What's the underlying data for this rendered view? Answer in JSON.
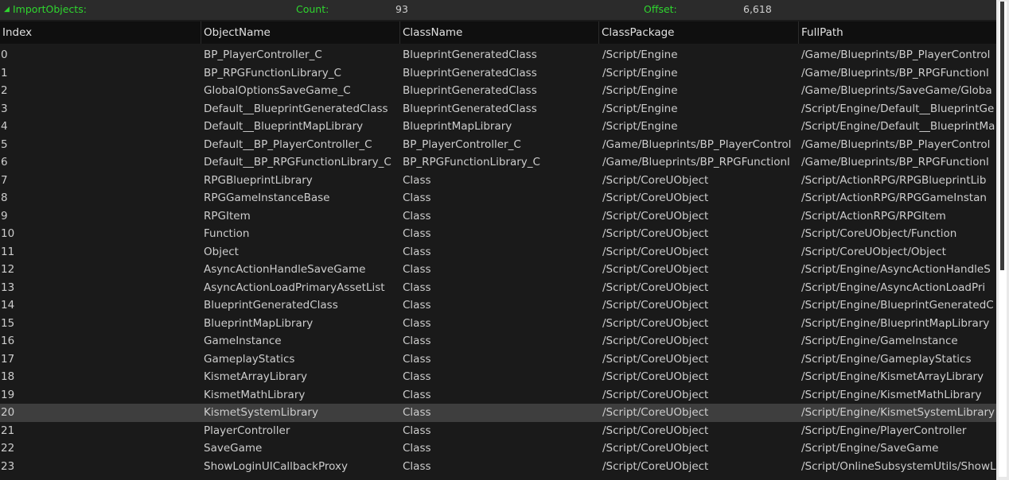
{
  "summary": {
    "title": "ImportObjects:",
    "count_label": "Count:",
    "count_value": "93",
    "offset_label": "Offset:",
    "offset_value": "6,618"
  },
  "columns": [
    "Index",
    "ObjectName",
    "ClassName",
    "ClassPackage",
    "FullPath"
  ],
  "selected_index": "20",
  "rows": [
    [
      "0",
      "BP_PlayerController_C",
      "BlueprintGeneratedClass",
      "/Script/Engine",
      "/Game/Blueprints/BP_PlayerControl"
    ],
    [
      "1",
      "BP_RPGFunctionLibrary_C",
      "BlueprintGeneratedClass",
      "/Script/Engine",
      "/Game/Blueprints/BP_RPGFunctionl"
    ],
    [
      "2",
      "GlobalOptionsSaveGame_C",
      "BlueprintGeneratedClass",
      "/Script/Engine",
      "/Game/Blueprints/SaveGame/Globa"
    ],
    [
      "3",
      "Default__BlueprintGeneratedClass",
      "BlueprintGeneratedClass",
      "/Script/Engine",
      "/Script/Engine/Default__BlueprintGe"
    ],
    [
      "4",
      "Default__BlueprintMapLibrary",
      "BlueprintMapLibrary",
      "/Script/Engine",
      "/Script/Engine/Default__BlueprintMa"
    ],
    [
      "5",
      "Default__BP_PlayerController_C",
      "BP_PlayerController_C",
      "/Game/Blueprints/BP_PlayerControl",
      "/Game/Blueprints/BP_PlayerControl"
    ],
    [
      "6",
      "Default__BP_RPGFunctionLibrary_C",
      "BP_RPGFunctionLibrary_C",
      "/Game/Blueprints/BP_RPGFunctionl",
      "/Game/Blueprints/BP_RPGFunctionl"
    ],
    [
      "7",
      "RPGBlueprintLibrary",
      "Class",
      "/Script/CoreUObject",
      "/Script/ActionRPG/RPGBlueprintLib"
    ],
    [
      "8",
      "RPGGameInstanceBase",
      "Class",
      "/Script/CoreUObject",
      "/Script/ActionRPG/RPGGameInstan"
    ],
    [
      "9",
      "RPGItem",
      "Class",
      "/Script/CoreUObject",
      "/Script/ActionRPG/RPGItem"
    ],
    [
      "10",
      "Function",
      "Class",
      "/Script/CoreUObject",
      "/Script/CoreUObject/Function"
    ],
    [
      "11",
      "Object",
      "Class",
      "/Script/CoreUObject",
      "/Script/CoreUObject/Object"
    ],
    [
      "12",
      "AsyncActionHandleSaveGame",
      "Class",
      "/Script/CoreUObject",
      "/Script/Engine/AsyncActionHandleS"
    ],
    [
      "13",
      "AsyncActionLoadPrimaryAssetList",
      "Class",
      "/Script/CoreUObject",
      "/Script/Engine/AsyncActionLoadPri"
    ],
    [
      "14",
      "BlueprintGeneratedClass",
      "Class",
      "/Script/CoreUObject",
      "/Script/Engine/BlueprintGeneratedC"
    ],
    [
      "15",
      "BlueprintMapLibrary",
      "Class",
      "/Script/CoreUObject",
      "/Script/Engine/BlueprintMapLibrary"
    ],
    [
      "16",
      "GameInstance",
      "Class",
      "/Script/CoreUObject",
      "/Script/Engine/GameInstance"
    ],
    [
      "17",
      "GameplayStatics",
      "Class",
      "/Script/CoreUObject",
      "/Script/Engine/GameplayStatics"
    ],
    [
      "18",
      "KismetArrayLibrary",
      "Class",
      "/Script/CoreUObject",
      "/Script/Engine/KismetArrayLibrary"
    ],
    [
      "19",
      "KismetMathLibrary",
      "Class",
      "/Script/CoreUObject",
      "/Script/Engine/KismetMathLibrary"
    ],
    [
      "20",
      "KismetSystemLibrary",
      "Class",
      "/Script/CoreUObject",
      "/Script/Engine/KismetSystemLibrary"
    ],
    [
      "21",
      "PlayerController",
      "Class",
      "/Script/CoreUObject",
      "/Script/Engine/PlayerController"
    ],
    [
      "22",
      "SaveGame",
      "Class",
      "/Script/CoreUObject",
      "/Script/Engine/SaveGame"
    ],
    [
      "23",
      "ShowLoginUICallbackProxy",
      "Class",
      "/Script/CoreUObject",
      "/Script/OnlineSubsystemUtils/ShowL"
    ]
  ],
  "colors": {
    "label_green": "#2fd62f",
    "background": "#1a1a1a",
    "header_bg": "#0f0f0f",
    "selected_row": "#3e3e3e"
  }
}
